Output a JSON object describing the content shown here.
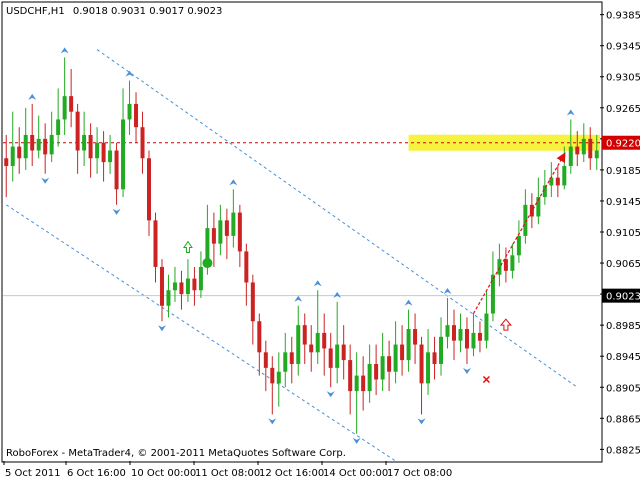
{
  "chart_data": {
    "type": "candlestick",
    "symbol_label": "USDCHF,H1",
    "ohlc_label": "0.9018 0.9031 0.9017 0.9023",
    "footer": "RoboForex - MetaTrader4, © 2001-2011 MetaQuotes Software Corp.",
    "ylim": [
      0.881,
      0.94
    ],
    "y_ticks": [
      0.9385,
      0.9345,
      0.9305,
      0.9265,
      0.9225,
      0.9185,
      0.9145,
      0.9105,
      0.9065,
      0.9025,
      0.8985,
      0.8945,
      0.8905,
      0.8865,
      0.8825
    ],
    "x_labels": [
      "5 Oct 2011",
      "6 Oct 16:00",
      "10 Oct 00:00",
      "11 Oct 08:00",
      "12 Oct 16:00",
      "14 Oct 00:00",
      "17 Oct 08:00"
    ],
    "current_price": 0.9023,
    "current_price_label": "0.9023",
    "target_level": 0.922,
    "target_label": "0.9220",
    "grid": false,
    "colors": {
      "bull": "#22aa22",
      "bear": "#cc2222",
      "channel": "#4a8fd8",
      "fractal": "#4a8fd8",
      "target_line": "#d40000",
      "target_zone": "#f6ef2a",
      "arrow": "#e01010"
    },
    "series": [
      {
        "o": 0.92,
        "c": 0.919,
        "h": 0.923,
        "l": 0.915
      },
      {
        "o": 0.919,
        "c": 0.9215,
        "h": 0.926,
        "l": 0.917
      },
      {
        "o": 0.9215,
        "c": 0.92,
        "h": 0.924,
        "l": 0.918
      },
      {
        "o": 0.92,
        "c": 0.923,
        "h": 0.9265,
        "l": 0.9185
      },
      {
        "o": 0.923,
        "c": 0.921,
        "h": 0.927,
        "l": 0.919
      },
      {
        "o": 0.921,
        "c": 0.9225,
        "h": 0.9255,
        "l": 0.92
      },
      {
        "o": 0.9225,
        "c": 0.9205,
        "h": 0.9245,
        "l": 0.918
      },
      {
        "o": 0.9205,
        "c": 0.923,
        "h": 0.926,
        "l": 0.9195
      },
      {
        "o": 0.923,
        "c": 0.925,
        "h": 0.929,
        "l": 0.9215
      },
      {
        "o": 0.925,
        "c": 0.928,
        "h": 0.933,
        "l": 0.923
      },
      {
        "o": 0.928,
        "c": 0.926,
        "h": 0.9315,
        "l": 0.924
      },
      {
        "o": 0.926,
        "c": 0.921,
        "h": 0.927,
        "l": 0.918
      },
      {
        "o": 0.921,
        "c": 0.923,
        "h": 0.926,
        "l": 0.919
      },
      {
        "o": 0.923,
        "c": 0.92,
        "h": 0.9245,
        "l": 0.9175
      },
      {
        "o": 0.92,
        "c": 0.922,
        "h": 0.924,
        "l": 0.918
      },
      {
        "o": 0.922,
        "c": 0.9195,
        "h": 0.9235,
        "l": 0.917
      },
      {
        "o": 0.9195,
        "c": 0.921,
        "h": 0.923,
        "l": 0.918
      },
      {
        "o": 0.921,
        "c": 0.916,
        "h": 0.922,
        "l": 0.914
      },
      {
        "o": 0.916,
        "c": 0.925,
        "h": 0.929,
        "l": 0.915
      },
      {
        "o": 0.925,
        "c": 0.927,
        "h": 0.93,
        "l": 0.923
      },
      {
        "o": 0.927,
        "c": 0.924,
        "h": 0.9285,
        "l": 0.922
      },
      {
        "o": 0.924,
        "c": 0.92,
        "h": 0.926,
        "l": 0.918
      },
      {
        "o": 0.92,
        "c": 0.912,
        "h": 0.921,
        "l": 0.91
      },
      {
        "o": 0.912,
        "c": 0.906,
        "h": 0.913,
        "l": 0.904
      },
      {
        "o": 0.906,
        "c": 0.901,
        "h": 0.907,
        "l": 0.899
      },
      {
        "o": 0.901,
        "c": 0.903,
        "h": 0.905,
        "l": 0.8995
      },
      {
        "o": 0.903,
        "c": 0.904,
        "h": 0.906,
        "l": 0.9015
      },
      {
        "o": 0.904,
        "c": 0.9025,
        "h": 0.9055,
        "l": 0.9005
      },
      {
        "o": 0.9025,
        "c": 0.9045,
        "h": 0.907,
        "l": 0.9015
      },
      {
        "o": 0.9045,
        "c": 0.903,
        "h": 0.906,
        "l": 0.901
      },
      {
        "o": 0.903,
        "c": 0.906,
        "h": 0.908,
        "l": 0.902
      },
      {
        "o": 0.906,
        "c": 0.911,
        "h": 0.914,
        "l": 0.905
      },
      {
        "o": 0.911,
        "c": 0.909,
        "h": 0.913,
        "l": 0.906
      },
      {
        "o": 0.909,
        "c": 0.912,
        "h": 0.914,
        "l": 0.9075
      },
      {
        "o": 0.912,
        "c": 0.91,
        "h": 0.9135,
        "l": 0.907
      },
      {
        "o": 0.91,
        "c": 0.913,
        "h": 0.916,
        "l": 0.9085
      },
      {
        "o": 0.913,
        "c": 0.908,
        "h": 0.914,
        "l": 0.906
      },
      {
        "o": 0.908,
        "c": 0.904,
        "h": 0.909,
        "l": 0.901
      },
      {
        "o": 0.904,
        "c": 0.899,
        "h": 0.905,
        "l": 0.896
      },
      {
        "o": 0.899,
        "c": 0.895,
        "h": 0.9,
        "l": 0.892
      },
      {
        "o": 0.895,
        "c": 0.893,
        "h": 0.8965,
        "l": 0.89
      },
      {
        "o": 0.893,
        "c": 0.891,
        "h": 0.8945,
        "l": 0.887
      },
      {
        "o": 0.891,
        "c": 0.8925,
        "h": 0.895,
        "l": 0.888
      },
      {
        "o": 0.8925,
        "c": 0.895,
        "h": 0.8975,
        "l": 0.8905
      },
      {
        "o": 0.895,
        "c": 0.8935,
        "h": 0.897,
        "l": 0.891
      },
      {
        "o": 0.8935,
        "c": 0.8985,
        "h": 0.901,
        "l": 0.892
      },
      {
        "o": 0.8985,
        "c": 0.896,
        "h": 0.9,
        "l": 0.8935
      },
      {
        "o": 0.896,
        "c": 0.895,
        "h": 0.8985,
        "l": 0.8925
      },
      {
        "o": 0.895,
        "c": 0.8975,
        "h": 0.903,
        "l": 0.8935
      },
      {
        "o": 0.8975,
        "c": 0.8955,
        "h": 0.9,
        "l": 0.892
      },
      {
        "o": 0.8955,
        "c": 0.893,
        "h": 0.8975,
        "l": 0.8905
      },
      {
        "o": 0.893,
        "c": 0.896,
        "h": 0.9015,
        "l": 0.891
      },
      {
        "o": 0.896,
        "c": 0.894,
        "h": 0.8985,
        "l": 0.8915
      },
      {
        "o": 0.894,
        "c": 0.89,
        "h": 0.896,
        "l": 0.887
      },
      {
        "o": 0.89,
        "c": 0.892,
        "h": 0.895,
        "l": 0.8845
      },
      {
        "o": 0.892,
        "c": 0.89,
        "h": 0.8945,
        "l": 0.8875
      },
      {
        "o": 0.89,
        "c": 0.8935,
        "h": 0.896,
        "l": 0.8885
      },
      {
        "o": 0.8935,
        "c": 0.8915,
        "h": 0.896,
        "l": 0.8895
      },
      {
        "o": 0.8915,
        "c": 0.8945,
        "h": 0.8975,
        "l": 0.89
      },
      {
        "o": 0.8945,
        "c": 0.8925,
        "h": 0.8965,
        "l": 0.89
      },
      {
        "o": 0.8925,
        "c": 0.896,
        "h": 0.899,
        "l": 0.891
      },
      {
        "o": 0.896,
        "c": 0.894,
        "h": 0.8985,
        "l": 0.892
      },
      {
        "o": 0.894,
        "c": 0.898,
        "h": 0.9005,
        "l": 0.8925
      },
      {
        "o": 0.898,
        "c": 0.896,
        "h": 0.9,
        "l": 0.8935
      },
      {
        "o": 0.896,
        "c": 0.891,
        "h": 0.897,
        "l": 0.887
      },
      {
        "o": 0.891,
        "c": 0.895,
        "h": 0.898,
        "l": 0.8895
      },
      {
        "o": 0.895,
        "c": 0.8935,
        "h": 0.897,
        "l": 0.8915
      },
      {
        "o": 0.8935,
        "c": 0.897,
        "h": 0.8995,
        "l": 0.892
      },
      {
        "o": 0.897,
        "c": 0.8985,
        "h": 0.902,
        "l": 0.8955
      },
      {
        "o": 0.8985,
        "c": 0.8965,
        "h": 0.9005,
        "l": 0.894
      },
      {
        "o": 0.8965,
        "c": 0.898,
        "h": 0.9,
        "l": 0.895
      },
      {
        "o": 0.898,
        "c": 0.8955,
        "h": 0.8995,
        "l": 0.8935
      },
      {
        "o": 0.8955,
        "c": 0.8975,
        "h": 0.9,
        "l": 0.8945
      },
      {
        "o": 0.8975,
        "c": 0.8965,
        "h": 0.899,
        "l": 0.895
      },
      {
        "o": 0.8965,
        "c": 0.9,
        "h": 0.903,
        "l": 0.8955
      },
      {
        "o": 0.9,
        "c": 0.905,
        "h": 0.908,
        "l": 0.899
      },
      {
        "o": 0.905,
        "c": 0.907,
        "h": 0.909,
        "l": 0.9035
      },
      {
        "o": 0.907,
        "c": 0.9055,
        "h": 0.9085,
        "l": 0.904
      },
      {
        "o": 0.9055,
        "c": 0.9075,
        "h": 0.909,
        "l": 0.9045
      },
      {
        "o": 0.9075,
        "c": 0.91,
        "h": 0.912,
        "l": 0.9065
      },
      {
        "o": 0.91,
        "c": 0.914,
        "h": 0.916,
        "l": 0.909
      },
      {
        "o": 0.914,
        "c": 0.9125,
        "h": 0.9155,
        "l": 0.911
      },
      {
        "o": 0.9125,
        "c": 0.915,
        "h": 0.9175,
        "l": 0.9115
      },
      {
        "o": 0.915,
        "c": 0.9165,
        "h": 0.9185,
        "l": 0.914
      },
      {
        "o": 0.9165,
        "c": 0.9175,
        "h": 0.9195,
        "l": 0.915
      },
      {
        "o": 0.9175,
        "c": 0.9165,
        "h": 0.919,
        "l": 0.915
      },
      {
        "o": 0.9165,
        "c": 0.919,
        "h": 0.9215,
        "l": 0.916
      },
      {
        "o": 0.919,
        "c": 0.9215,
        "h": 0.925,
        "l": 0.918
      },
      {
        "o": 0.9215,
        "c": 0.9205,
        "h": 0.9235,
        "l": 0.919
      },
      {
        "o": 0.9205,
        "c": 0.9225,
        "h": 0.9245,
        "l": 0.9195
      },
      {
        "o": 0.9225,
        "c": 0.92,
        "h": 0.924,
        "l": 0.9185
      },
      {
        "o": 0.92,
        "c": 0.921,
        "h": 0.923,
        "l": 0.9185
      }
    ]
  }
}
